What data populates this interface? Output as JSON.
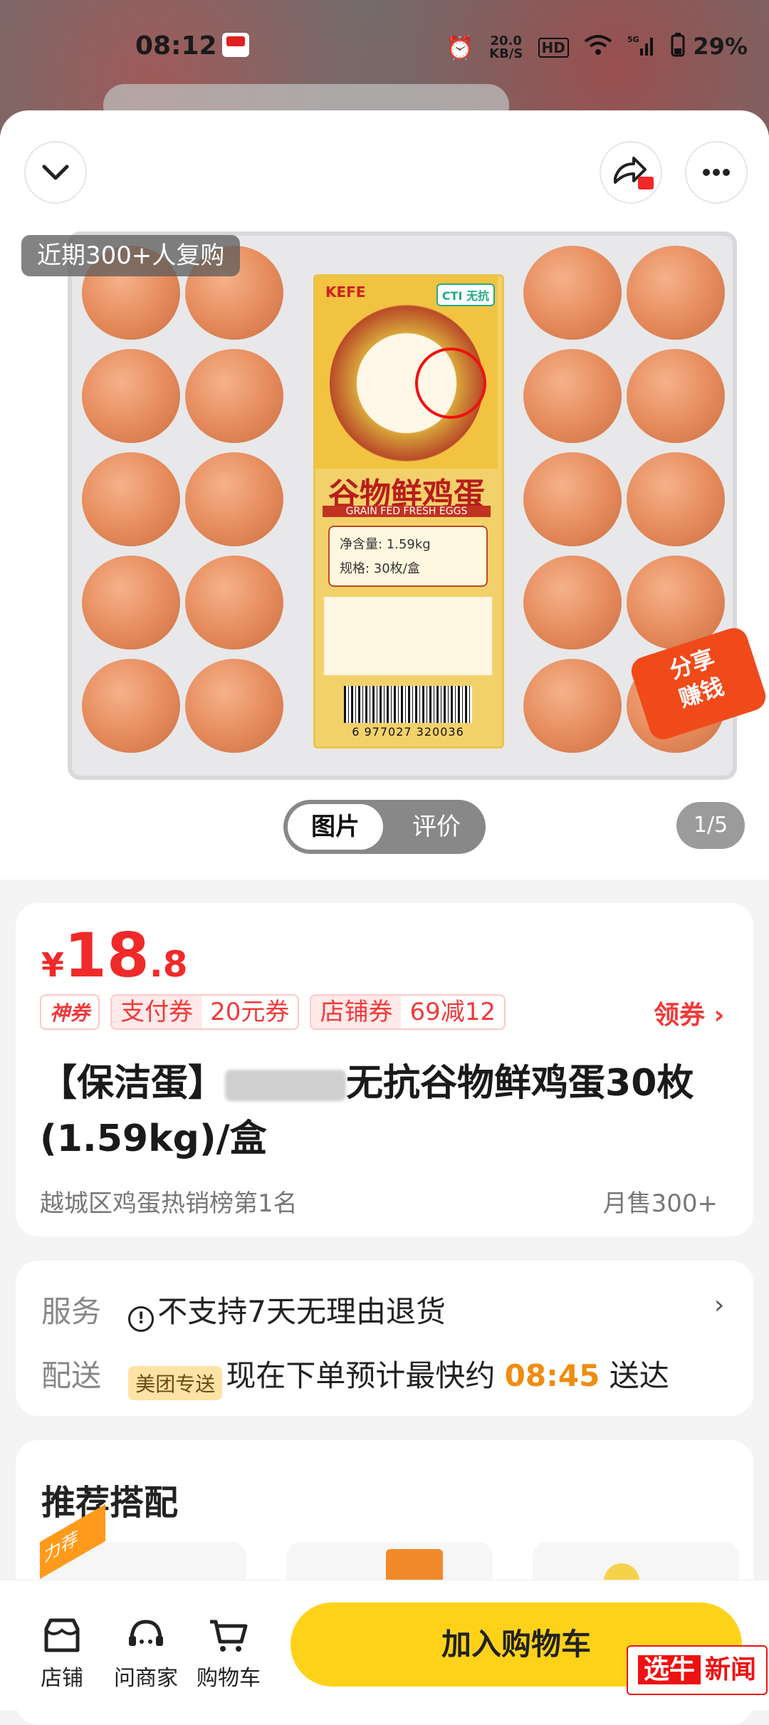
{
  "status_bar": {
    "time": "08:12",
    "speed": "20.0\nKB/S",
    "hd": "HD",
    "signal": "5G",
    "battery": "29%"
  },
  "header": {
    "collapse_icon": "chevron-down-icon",
    "share_icon": "share-arrow-icon",
    "more_icon": "more-horizontal-icon"
  },
  "gallery": {
    "repurchase_badge": "近期300+人复购",
    "tabs": [
      "图片",
      "评价"
    ],
    "pager": "1/5",
    "share_promo": "分享\n赚钱",
    "label": {
      "title": "谷物鲜鸡蛋",
      "subtitle": "GRAIN FED FRESH EGGS",
      "net": "净含量: 1.59kg",
      "spec": "规格: 30枚/盒",
      "barcode": "6 977027 320036",
      "cti": "CTI 无抗"
    }
  },
  "price": {
    "currency": "¥",
    "integer": "18",
    "decimal": ".8"
  },
  "coupons": {
    "shen": "神券",
    "pay_label": "支付券",
    "pay_value": "20元券",
    "store_label": "店铺券",
    "store_value": "69减12",
    "get": "领券 ›"
  },
  "product": {
    "title_prefix": "【保洁蛋】",
    "title_suffix": "无抗谷物鲜鸡蛋30枚(1.59kg)/盒",
    "rank": "越城区鸡蛋热销榜第1名",
    "sold": "月售300+"
  },
  "service": {
    "label": "服务",
    "text": "不支持7天无理由退货",
    "delivery_label": "配送",
    "badge": "美团专送",
    "delivery_prefix": "现在下单预计最快约 ",
    "delivery_time": "08:45",
    "delivery_suffix": " 送达"
  },
  "recommend": {
    "title": "推荐搭配",
    "badge": "力荐"
  },
  "bottom": {
    "store": "店铺",
    "ask": "问商家",
    "cart": "购物车",
    "add_to_cart": "加入购物车"
  },
  "watermark": {
    "mark": "选牛",
    "text": "新闻"
  }
}
